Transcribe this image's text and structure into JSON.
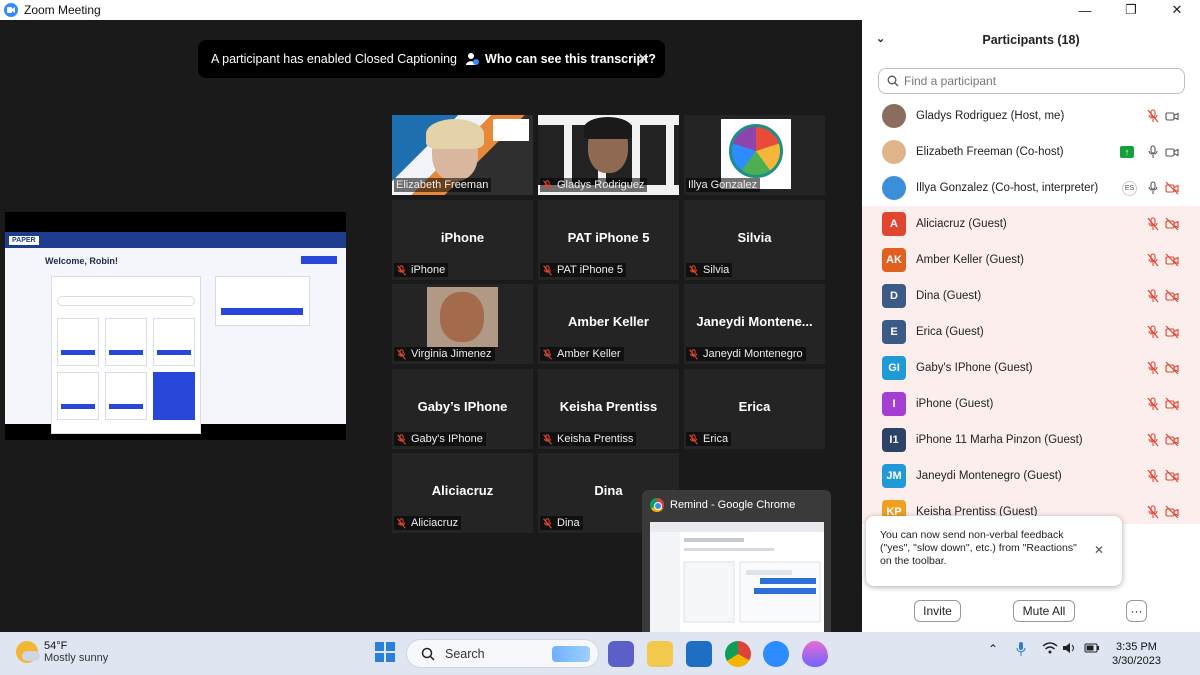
{
  "window": {
    "title": "Zoom Meeting",
    "controls": [
      "—",
      "❐",
      "✕"
    ]
  },
  "cc_banner": {
    "message": "A participant has enabled Closed Captioning",
    "link": "Who can see this transcript?",
    "close": "✕"
  },
  "shared_screen": {
    "app_logo": "PAPER",
    "welcome": "Welcome, Robin!"
  },
  "tiles": [
    {
      "name": "Elizabeth Freeman",
      "center": "",
      "video": true,
      "muted": false,
      "active": true
    },
    {
      "name": "Gladys Rodriguez",
      "center": "",
      "video": true,
      "muted": true,
      "active": false
    },
    {
      "name": "Illya Gonzalez",
      "center": "",
      "video": true,
      "muted": false,
      "active": false
    },
    {
      "name": "iPhone",
      "center": "iPhone",
      "video": false,
      "muted": true
    },
    {
      "name": "PAT iPhone 5",
      "center": "PAT iPhone 5",
      "video": false,
      "muted": true
    },
    {
      "name": "Silvia",
      "center": "Silvia",
      "video": false,
      "muted": true
    },
    {
      "name": "Virginia Jimenez",
      "center": "",
      "video": true,
      "muted": true
    },
    {
      "name": "Amber Keller",
      "center": "Amber Keller",
      "video": false,
      "muted": true
    },
    {
      "name": "Janeydi Montenegro",
      "center": "Janeydi  Montene...",
      "video": false,
      "muted": true
    },
    {
      "name": "Gaby's IPhone",
      "center": "Gaby’s IPhone",
      "video": false,
      "muted": true
    },
    {
      "name": "Keisha Prentiss",
      "center": "Keisha Prentiss",
      "video": false,
      "muted": true
    },
    {
      "name": "Erica",
      "center": "Erica",
      "video": false,
      "muted": true
    },
    {
      "name": "Aliciacruz",
      "center": "Aliciacruz",
      "video": false,
      "muted": true
    },
    {
      "name": "Dina",
      "center": "Dina",
      "video": false,
      "muted": true
    }
  ],
  "remind_preview": {
    "title": "Remind - Google Chrome"
  },
  "participants": {
    "header": "Participants (18)",
    "search_placeholder": "Find a participant",
    "list": [
      {
        "name": "Gladys Rodriguez (Host, me)",
        "initials": "",
        "color": "#8a6d5c",
        "photo": true,
        "mic": "muted",
        "cam": "on",
        "guest": false
      },
      {
        "name": "Elizabeth Freeman (Co-host)",
        "initials": "",
        "color": "#e0b48a",
        "photo": true,
        "mic": "on",
        "cam": "on",
        "guest": false,
        "sharing": true
      },
      {
        "name": "Illya Gonzalez (Co-host, interpreter)",
        "initials": "",
        "color": "#3a8fd8",
        "photo": true,
        "mic": "on",
        "cam": "off",
        "guest": false,
        "lang": "ES"
      },
      {
        "name": "Aliciacruz (Guest)",
        "initials": "A",
        "color": "#e0452f",
        "mic": "muted",
        "cam": "off",
        "guest": true
      },
      {
        "name": "Amber Keller (Guest)",
        "initials": "AK",
        "color": "#e0601f",
        "mic": "muted",
        "cam": "off",
        "guest": true
      },
      {
        "name": "Dina (Guest)",
        "initials": "D",
        "color": "#3c5a86",
        "mic": "muted",
        "cam": "off",
        "guest": true
      },
      {
        "name": "Erica (Guest)",
        "initials": "E",
        "color": "#3c5a86",
        "mic": "muted",
        "cam": "off",
        "guest": true
      },
      {
        "name": "Gaby's IPhone (Guest)",
        "initials": "GI",
        "color": "#1f9ad6",
        "mic": "muted",
        "cam": "off",
        "guest": true
      },
      {
        "name": "iPhone (Guest)",
        "initials": "I",
        "color": "#a43fd1",
        "mic": "muted",
        "cam": "off",
        "guest": true
      },
      {
        "name": "iPhone 11 Marha Pinzon (Guest)",
        "initials": "I1",
        "color": "#2c4366",
        "mic": "muted",
        "cam": "off",
        "guest": true
      },
      {
        "name": "Janeydi Montenegro (Guest)",
        "initials": "JM",
        "color": "#1f9ad6",
        "mic": "muted",
        "cam": "off",
        "guest": true
      },
      {
        "name": "Keisha Prentiss (Guest)",
        "initials": "KP",
        "color": "#f0a020",
        "mic": "muted",
        "cam": "off",
        "guest": true
      }
    ],
    "toast": "You can now send non-verbal feedback (\"yes\", \"slow down\", etc.) from \"Reactions\" on the toolbar.",
    "invite": "Invite",
    "mute_all": "Mute All",
    "more": "···"
  },
  "taskbar": {
    "temp": "54°F",
    "weather": "Mostly sunny",
    "search": "Search",
    "time": "3:35 PM",
    "date": "3/30/2023"
  }
}
